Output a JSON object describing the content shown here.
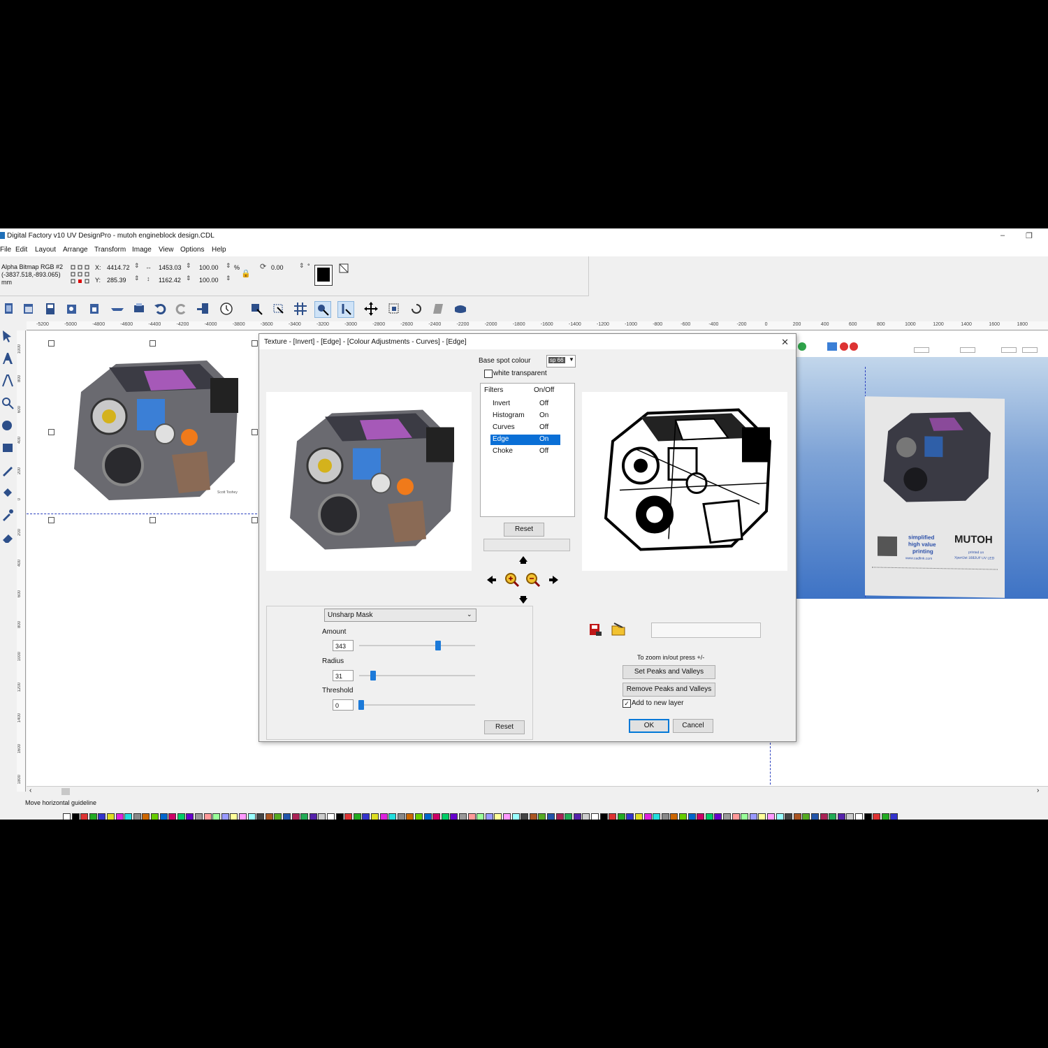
{
  "window": {
    "title": "Digital Factory v10 UV DesignPro - mutoh engineblock design.CDL",
    "minimize": "–",
    "restore": "❐"
  },
  "menu": [
    "File",
    "Edit",
    "Layout",
    "Arrange",
    "Transform",
    "Image",
    "View",
    "Options",
    "Help"
  ],
  "properties": {
    "object_name": "Alpha Bitmap RGB #2",
    "object_coords": "(-3837.518,-893.065)",
    "units": "mm",
    "x_label": "X:",
    "y_label": "Y:",
    "x": "4414.72",
    "y": "285.39",
    "width": "1453.03",
    "height": "1162.42",
    "scale_w": "100.00",
    "scale_h": "100.00",
    "pct": "%",
    "rotation": "0.00",
    "deg": "°"
  },
  "ruler": {
    "top_labels": [
      "-5200",
      "-5000",
      "-4800",
      "-4600",
      "-4400",
      "-4200",
      "-4000",
      "-3800",
      "-3600",
      "-3400",
      "-3200",
      "-3000",
      "-2800",
      "-2600",
      "-2400",
      "-2200",
      "-2000",
      "-1800",
      "-1600",
      "-1400",
      "-1200",
      "-1000",
      "-800",
      "-600",
      "-400",
      "-200",
      "0",
      "200",
      "400",
      "600",
      "800",
      "1000",
      "1200",
      "1400",
      "1600",
      "1800"
    ],
    "left_labels": [
      "1000",
      "800",
      "600",
      "400",
      "200",
      "0",
      "200",
      "400",
      "600",
      "800",
      "1000",
      "1200",
      "1400",
      "1600",
      "1800"
    ]
  },
  "dialog": {
    "title": "Texture - [Invert] - [Edge] - [Colour Adjustments - Curves] - [Edge]",
    "close": "✕",
    "base_spot_label": "Base spot colour",
    "base_spot_value": "sp 66",
    "white_transparent": "white transparent",
    "filters_header": "Filters",
    "onoff_header": "On/Off",
    "filters": [
      {
        "name": "Invert",
        "state": "Off"
      },
      {
        "name": "Histogram",
        "state": "On"
      },
      {
        "name": "Curves",
        "state": "Off"
      },
      {
        "name": "Edge",
        "state": "On"
      },
      {
        "name": "Choke",
        "state": "Off"
      }
    ],
    "reset_top": "Reset",
    "filter_type": "Unsharp Mask",
    "amount_label": "Amount",
    "amount": "343",
    "amount_pct": 0.68,
    "radius_label": "Radius",
    "radius": "31",
    "radius_pct": 0.12,
    "threshold_label": "Threshold",
    "threshold": "0",
    "threshold_pct": 0.02,
    "reset_bottom": "Reset",
    "zoom_hint": "To zoom in/out press +/-",
    "set_peaks": "Set Peaks and Valleys",
    "remove_peaks": "Remove Peaks and Valleys",
    "add_new_layer": "Add to new layer",
    "ok": "OK",
    "cancel": "Cancel",
    "signature": "Scott Toohey"
  },
  "preview3d": {
    "tagline_1": "simplified",
    "tagline_2": "high value",
    "tagline_3": "printing",
    "brand": "MUTOH",
    "printed_on": "printed on",
    "printer": "XpertJet 1682UF UV LED",
    "website": "www.cadlink.com"
  },
  "status": {
    "text": "Move horizontal guideline"
  },
  "colors": {
    "accent": "#0a6fd6",
    "thumb": "#1c7ad9",
    "preview_top": "#cfe0ef",
    "preview_bottom": "#3e73c5"
  }
}
